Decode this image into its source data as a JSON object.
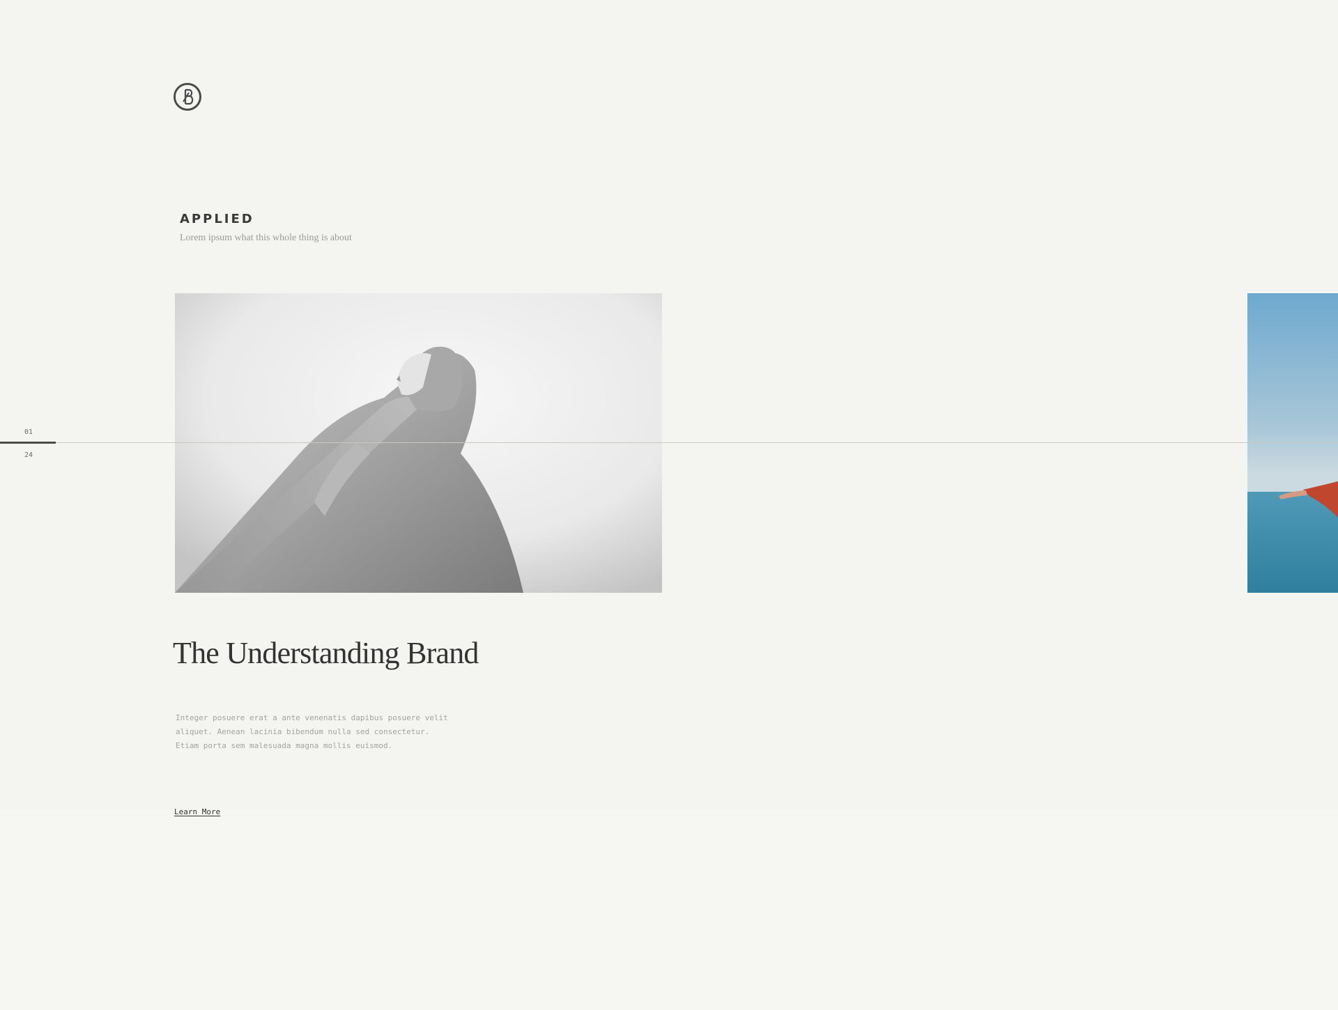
{
  "section": {
    "label": "APPLIED",
    "subtitle": "Lorem ipsum what this whole thing is about"
  },
  "slider": {
    "current": "01",
    "total": "24",
    "progress": 0.0417
  },
  "slide": {
    "title": "The Understanding Brand",
    "body_lines": [
      "Integer posuere erat a ante venenatis dapibus posuere velit",
      "aliquet. Aenean lacinia bibendum nulla sed consectetur.",
      "Etiam porta sem malesuada magna mollis euismod."
    ],
    "link_label": "Learn More"
  },
  "colors": {
    "background": "#f4f4f0",
    "text": "#333333",
    "muted": "#a3a39f",
    "accent_sky": "#6ea9cf",
    "accent_sea": "#3f8fae",
    "accent_sleeve": "#c1462e"
  }
}
